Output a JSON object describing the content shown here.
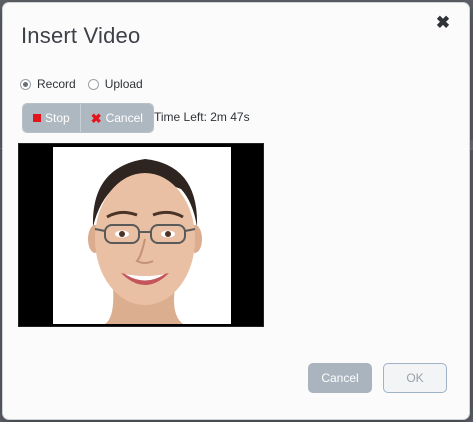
{
  "dialog": {
    "title": "Insert Video",
    "close_icon": "close-icon"
  },
  "source": {
    "options": [
      {
        "label": "Record",
        "selected": true
      },
      {
        "label": "Upload",
        "selected": false
      }
    ]
  },
  "recorder": {
    "stop_label": "Stop",
    "cancel_label": "Cancel",
    "time_left": "Time Left: 2m 47s",
    "accent_color": "#e3141b"
  },
  "footer": {
    "cancel_label": "Cancel",
    "ok_label": "OK"
  }
}
